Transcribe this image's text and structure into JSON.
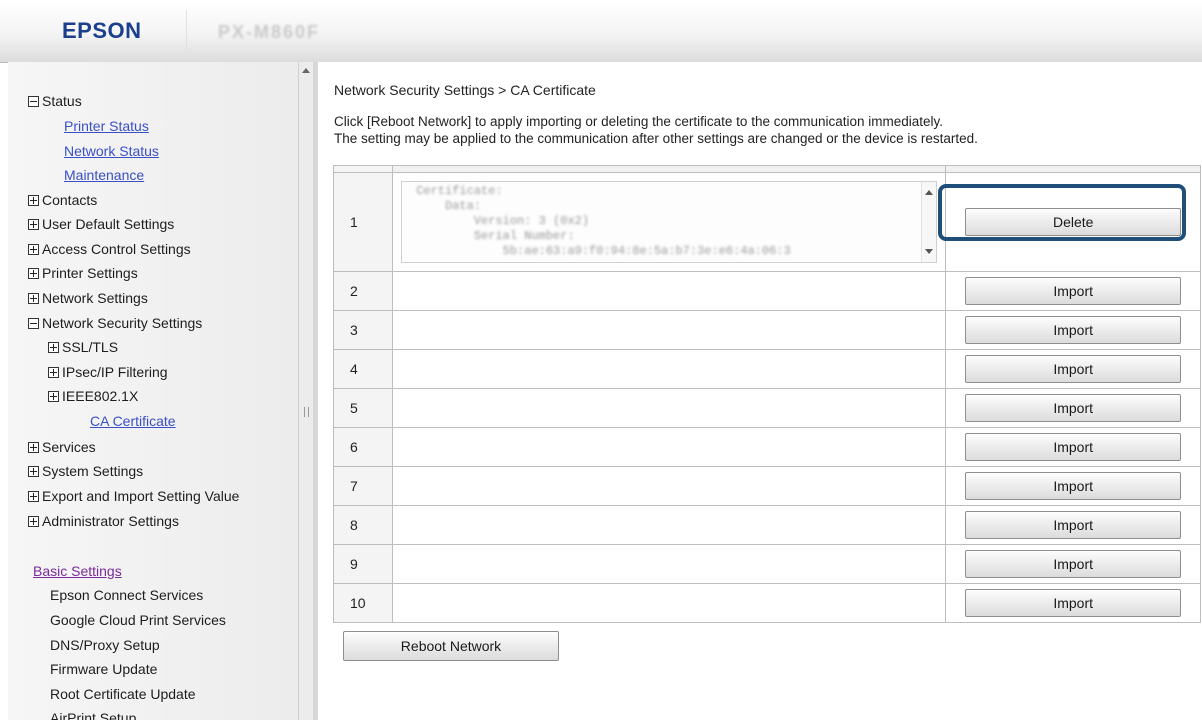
{
  "header": {
    "logo": "EPSON",
    "model": "PX-M860F"
  },
  "sidebar": {
    "items": [
      {
        "label": "Status",
        "kind": "expanded",
        "indent": 0
      },
      {
        "label": "Printer Status",
        "kind": "link",
        "indent": 2
      },
      {
        "label": "Network Status",
        "kind": "link",
        "indent": 2
      },
      {
        "label": "Maintenance",
        "kind": "link",
        "indent": 2
      },
      {
        "label": "Contacts",
        "kind": "collapsed",
        "indent": 0
      },
      {
        "label": "User Default Settings",
        "kind": "collapsed",
        "indent": 0
      },
      {
        "label": "Access Control Settings",
        "kind": "collapsed",
        "indent": 0
      },
      {
        "label": "Printer Settings",
        "kind": "collapsed",
        "indent": 0
      },
      {
        "label": "Network Settings",
        "kind": "collapsed",
        "indent": 0
      },
      {
        "label": "Network Security Settings",
        "kind": "expanded",
        "indent": 0
      },
      {
        "label": "SSL/TLS",
        "kind": "collapsed",
        "indent": 1
      },
      {
        "label": "IPsec/IP Filtering",
        "kind": "collapsed",
        "indent": 1
      },
      {
        "label": "IEEE802.1X",
        "kind": "collapsed",
        "indent": 1
      },
      {
        "label": "CA Certificate",
        "kind": "link",
        "indent": 2
      },
      {
        "label": "Services",
        "kind": "collapsed",
        "indent": 0
      },
      {
        "label": "System Settings",
        "kind": "collapsed",
        "indent": 0
      },
      {
        "label": "Export and Import Setting Value",
        "kind": "collapsed",
        "indent": 0
      },
      {
        "label": "Administrator Settings",
        "kind": "collapsed",
        "indent": 0
      }
    ],
    "basic_settings": {
      "label": "Basic Settings",
      "items": [
        "Epson Connect Services",
        "Google Cloud Print Services",
        "DNS/Proxy Setup",
        "Firmware Update",
        "Root Certificate Update",
        "AirPrint Setup"
      ]
    }
  },
  "main": {
    "breadcrumb": "Network Security Settings > CA Certificate",
    "description_line1": "Click [Reboot Network] to apply importing or deleting the certificate to the communication immediately.",
    "description_line2": "The setting may be applied to the communication after other settings are changed or the device is restarted.",
    "certificate_text": "Certificate:\n    Data:\n        Version: 3 (0x2)\n        Serial Number:\n            5b:ae:63:a9:f0:94:8e:5a:b7:3e:e6:4a:06:3",
    "rows": [
      {
        "num": "1",
        "action": "Delete"
      },
      {
        "num": "2",
        "action": "Import"
      },
      {
        "num": "3",
        "action": "Import"
      },
      {
        "num": "4",
        "action": "Import"
      },
      {
        "num": "5",
        "action": "Import"
      },
      {
        "num": "6",
        "action": "Import"
      },
      {
        "num": "7",
        "action": "Import"
      },
      {
        "num": "8",
        "action": "Import"
      },
      {
        "num": "9",
        "action": "Import"
      },
      {
        "num": "10",
        "action": "Import"
      }
    ],
    "reboot_label": "Reboot Network"
  },
  "colors": {
    "brand": "#1b3f8f",
    "link": "#3a4fc7",
    "highlight": "#1f4e79"
  }
}
